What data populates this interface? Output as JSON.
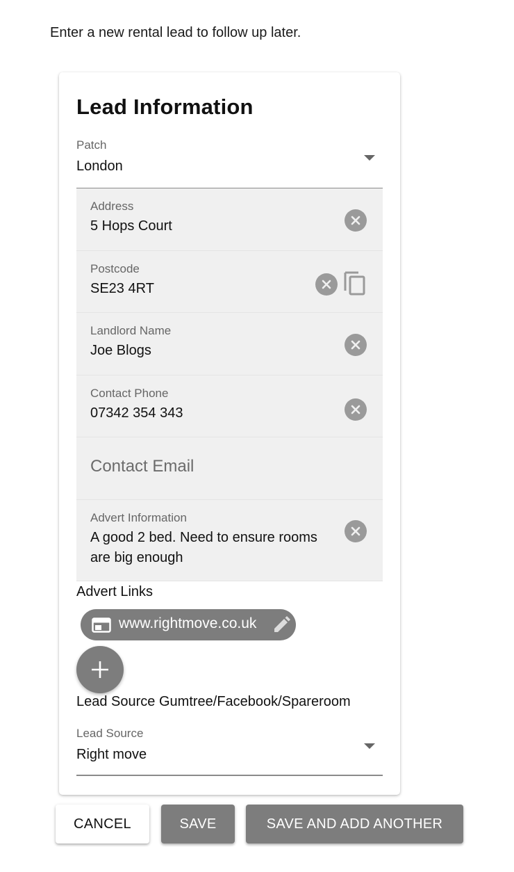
{
  "intro_text": "Enter a new rental lead to follow up later.",
  "card_title": "Lead Information",
  "patch": {
    "label": "Patch",
    "value": "London"
  },
  "fields": {
    "address": {
      "label": "Address",
      "value": "5 Hops Court"
    },
    "postcode": {
      "label": "Postcode",
      "value": "SE23 4RT"
    },
    "landlord": {
      "label": "Landlord Name",
      "value": "Joe Blogs"
    },
    "phone": {
      "label": "Contact Phone",
      "value": "07342 354 343"
    },
    "email": {
      "placeholder": "Contact Email"
    },
    "advert": {
      "label": "Advert Information",
      "value": "A good 2 bed. Need to ensure rooms are big enough"
    }
  },
  "advert_links": {
    "label": "Advert Links",
    "chips": [
      "www.rightmove.co.uk"
    ]
  },
  "lead_source_caption": "Lead Source Gumtree/Facebook/Spareroom",
  "lead_source": {
    "label": "Lead Source",
    "value": "Right move"
  },
  "buttons": {
    "cancel": "CANCEL",
    "save": "SAVE",
    "save_and_add": "SAVE AND ADD ANOTHER"
  },
  "icons": {
    "clear": "clear-circle-icon",
    "copy": "copy-icon",
    "chip_leading": "web-page-icon",
    "chip_trailing": "edit-pencil-icon",
    "add": "plus-icon",
    "dropdown": "dropdown-caret-icon"
  },
  "colors": {
    "chip_bg": "#7d7d7d",
    "field_bg": "#f0f0f0",
    "primary_button": "#7d7d7d"
  }
}
